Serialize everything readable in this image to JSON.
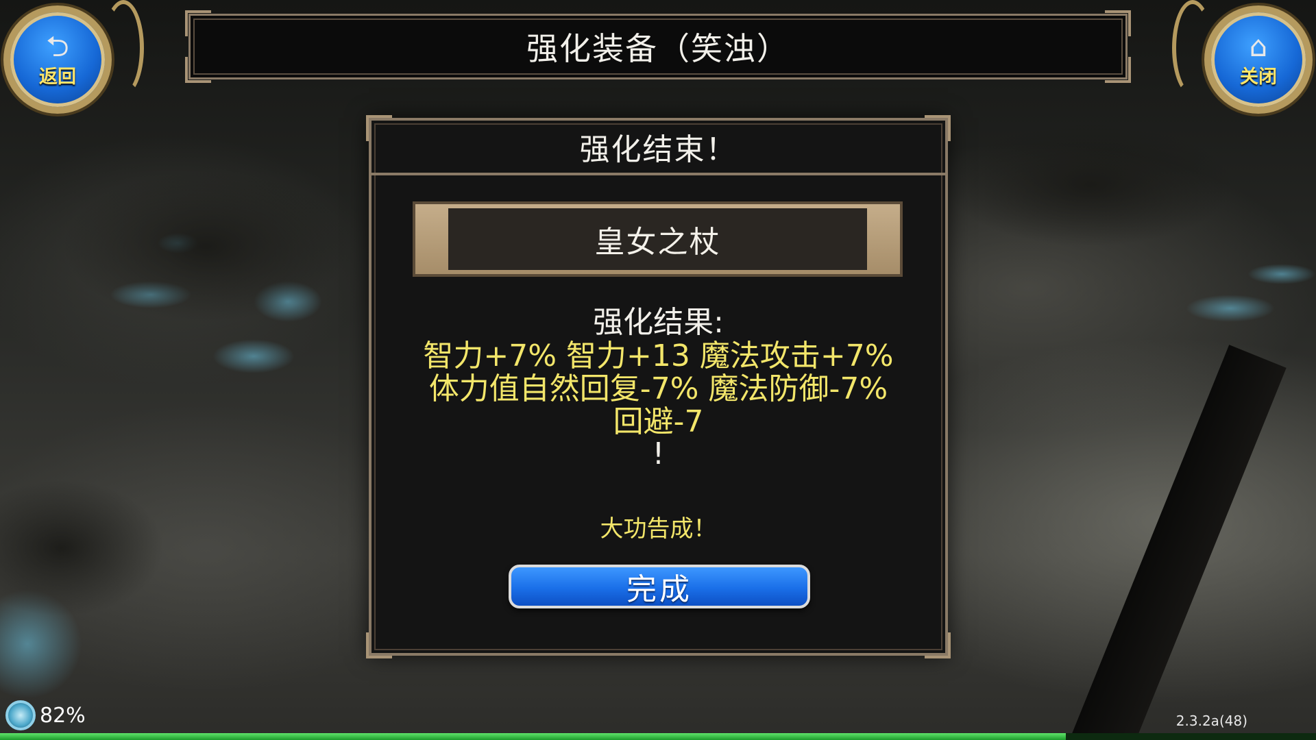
{
  "header": {
    "title": "强化装备（笑浊）",
    "back_label": "返回",
    "back_icon": "return-arrow-icon",
    "close_label": "关闭",
    "close_icon": "home-icon"
  },
  "dialog": {
    "title": "强化结束！",
    "item_name": "皇女之杖",
    "results_heading": "强化结果:",
    "result_lines": [
      "智力+7% 智力+13 魔法攻击+7%",
      "体力值自然回复-7% 魔法防御-7%",
      "回避-7"
    ],
    "results_end": "!",
    "success_text": "大功告成！",
    "done_label": "完成"
  },
  "status": {
    "battery": "82%",
    "version": "2.3.2a(48)",
    "exp_progress": 0.81
  },
  "colors": {
    "accent_blue": "#1a6fe8",
    "result_yellow": "#f3e66a",
    "frame_gold": "#8a7a66",
    "exp_green": "#1d9b2c"
  }
}
